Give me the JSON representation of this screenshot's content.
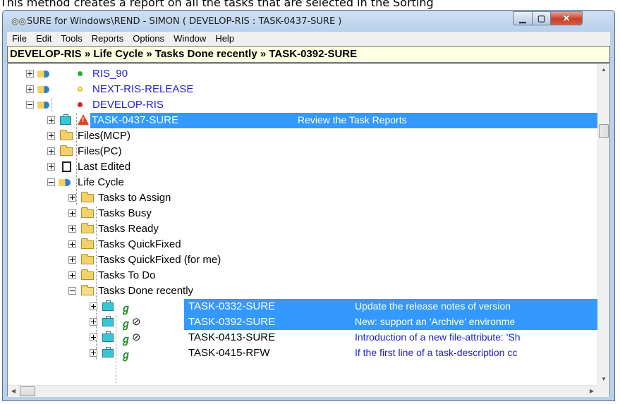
{
  "doc_text": "This method creates a report on all the tasks that are selected in the Sorting",
  "window": {
    "title": "SURE for Windows\\REND - SIMON ( DEVELOP-RIS : TASK-0437-SURE )",
    "minimize": "▁",
    "maximize": "▢",
    "close": "✕"
  },
  "menu": [
    "File",
    "Edit",
    "Tools",
    "Reports",
    "Options",
    "Window",
    "Help"
  ],
  "breadcrumb": "DEVELOP-RIS » Life Cycle » Tasks Done recently » TASK-0392-SURE",
  "tree": {
    "ris90": "RIS_90",
    "next_release": "NEXT-RIS-RELEASE",
    "develop": "DEVELOP-RIS",
    "task0437": {
      "name": "TASK-0437-SURE",
      "desc": "Review the Task Reports"
    },
    "files_mcp": "Files(MCP)",
    "files_pc": "Files(PC)",
    "last_edited": "Last Edited",
    "life_cycle": "Life Cycle",
    "folders": [
      "Tasks to Assign",
      "Tasks Busy",
      "Tasks Ready",
      "Tasks QuickFixed",
      "Tasks QuickFixed (for me)",
      "Tasks To Do"
    ],
    "done_recently": "Tasks Done recently",
    "tasks": [
      {
        "name": "TASK-0332-SURE",
        "desc": "Update the release notes of version"
      },
      {
        "name": "TASK-0392-SURE",
        "desc": "New: support an 'Archive' environme"
      },
      {
        "name": "TASK-0413-SURE",
        "desc": "Introduction of a new file-attribute: 'Sh"
      },
      {
        "name": "TASK-0415-RFW",
        "desc": "If the first line of a task-description cc"
      }
    ]
  },
  "colors": {
    "selection": "#3399ff",
    "link": "#1f1fcf",
    "dot_green": "#2fa82f",
    "dot_yellow": "#e8c300",
    "dot_red": "#d81e1e"
  }
}
